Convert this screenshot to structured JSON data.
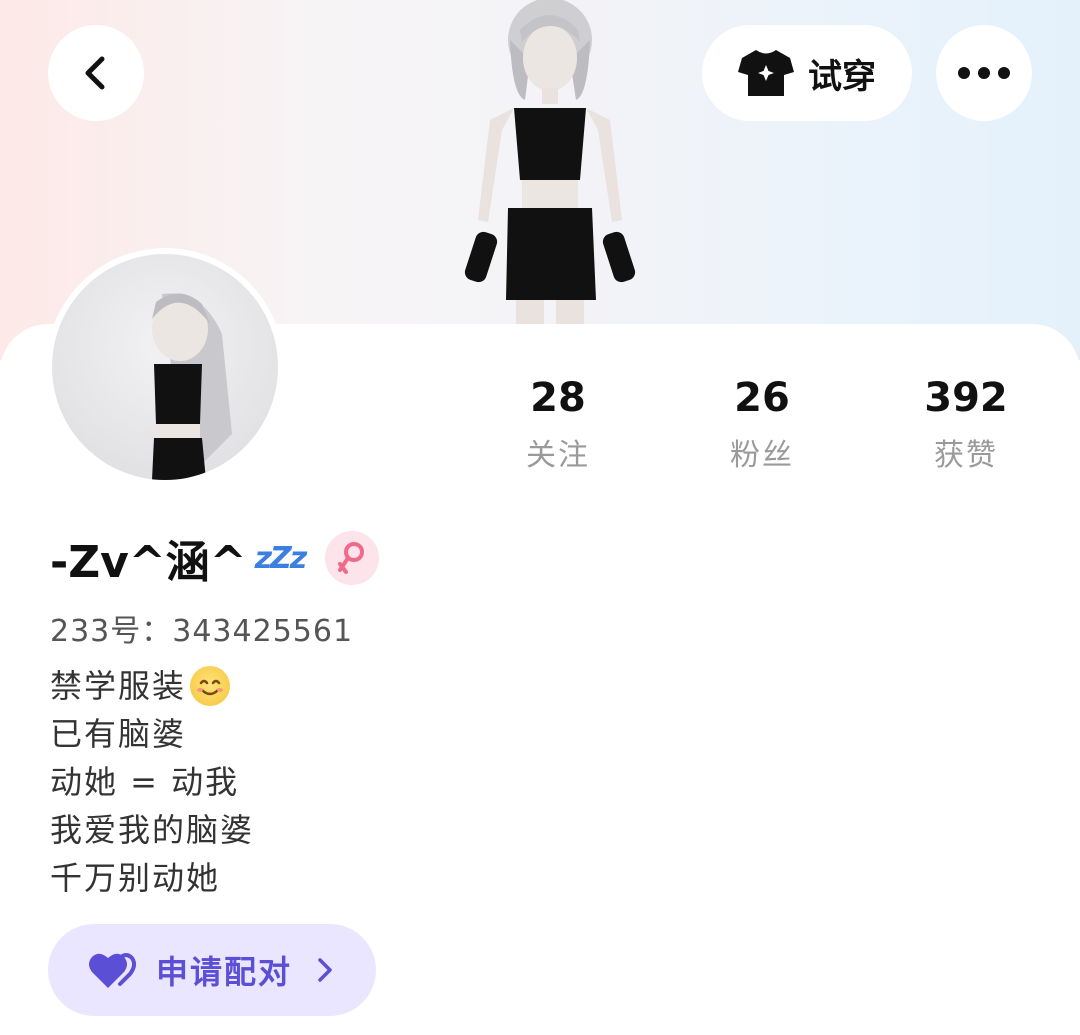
{
  "header": {
    "tryon_label": "试穿"
  },
  "stats": [
    {
      "value": "28",
      "label": "关注"
    },
    {
      "value": "26",
      "label": "粉丝"
    },
    {
      "value": "392",
      "label": "获赞"
    }
  ],
  "profile": {
    "nickname": "-Zv^涵^",
    "status_glyph": "zZz",
    "uid": "233号：343425561",
    "bio": [
      "禁学服装",
      "已有脑婆",
      "动她 = 动我",
      "我爱我的脑婆",
      "千万别动她"
    ]
  },
  "pair_button": {
    "label": "申请配对"
  },
  "colors": {
    "accent": "#5b4fd6",
    "gender_badge": "#f06a8c",
    "zzz": "#3b7fe0"
  }
}
